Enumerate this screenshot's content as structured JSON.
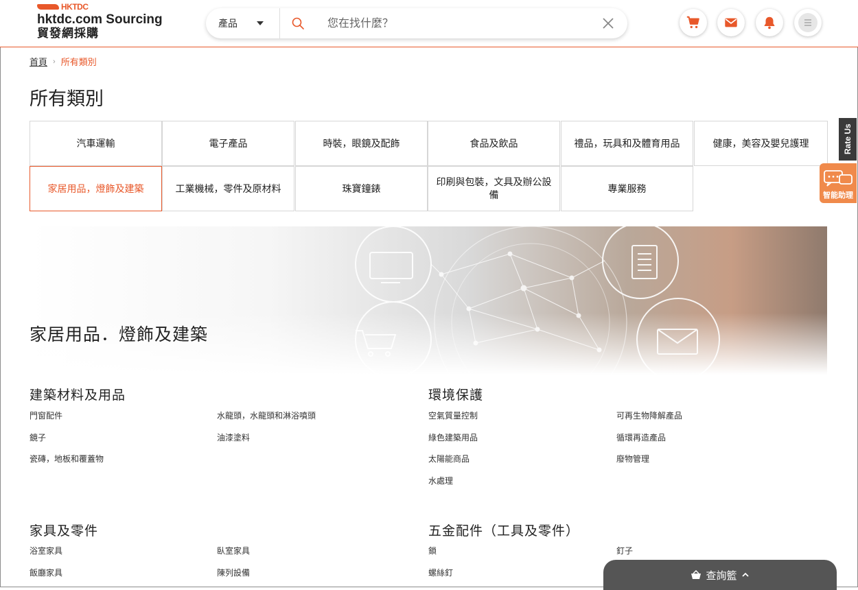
{
  "header": {
    "logo": {
      "brand": "HKTDC",
      "name_en": "hktdc.com Sourcing",
      "name_zh": "貿發網採購"
    },
    "search": {
      "category": "產品",
      "placeholder": "您在找什麼？"
    },
    "icons": [
      "cart-icon",
      "mail-icon",
      "bell-icon",
      "menu-icon"
    ]
  },
  "breadcrumb": {
    "home": "首頁",
    "current": "所有類別"
  },
  "page_title": "所有類別",
  "categories": [
    {
      "label": "汽車運輸"
    },
    {
      "label": "電子產品"
    },
    {
      "label": "時裝，眼鏡及配飾"
    },
    {
      "label": "食品及飲品"
    },
    {
      "label": "禮品，玩具和及體育用品"
    },
    {
      "label": "健康，美容及嬰兒護理"
    },
    {
      "label": "家居用品，燈飾及建築",
      "active": true
    },
    {
      "label": "工業機械，零件及原材料"
    },
    {
      "label": "珠寶鐘錶"
    },
    {
      "label": "印刷與包裝，文具及辦公設備"
    },
    {
      "label": "專業服務"
    }
  ],
  "side": {
    "rate_us": "Rate Us",
    "assistant": "智能助理"
  },
  "banner": {
    "title": "家居用品．燈飾及建築"
  },
  "sections": [
    {
      "title": "建築材料及用品",
      "items": [
        "門窗配件",
        "水龍頭，水龍頭和淋浴噴頭",
        "鏡子",
        "油漆塗料",
        "瓷磚，地板和覆蓋物"
      ]
    },
    {
      "title": "環境保護",
      "items": [
        "空氣質量控制",
        "可再生物降解產品",
        "綠色建築用品",
        "循環再造產品",
        "太陽能商品",
        "廢物管理",
        "水處理"
      ]
    },
    {
      "title": "家具及零件",
      "items": [
        "浴室家具",
        "臥室家具",
        "飯廳家具",
        "陳列設備"
      ]
    },
    {
      "title": "五金配件（工具及零件）",
      "items": [
        "鎖",
        "釘子",
        "螺絲釘"
      ]
    }
  ],
  "basket": {
    "label": "查詢籃"
  },
  "colors": {
    "accent": "#e8582a",
    "assistant": "#f08a4b",
    "basket": "#555555"
  }
}
